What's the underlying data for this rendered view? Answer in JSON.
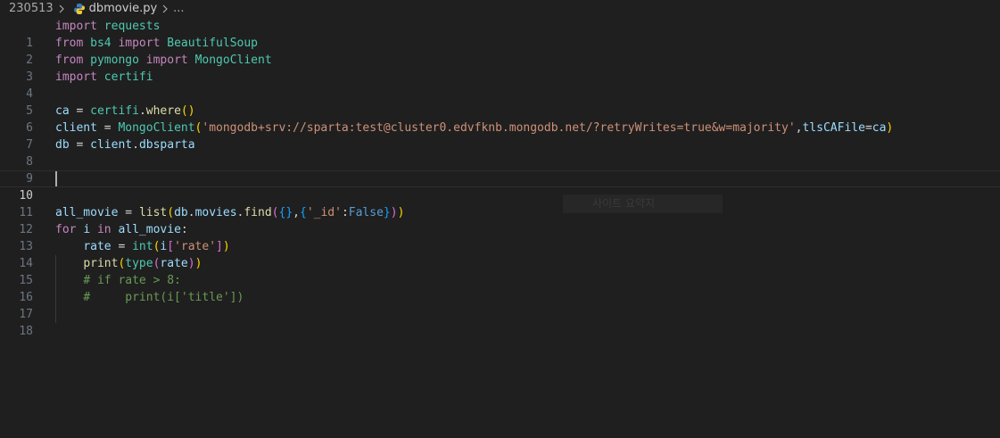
{
  "breadcrumb": {
    "folder": "230513",
    "file": "dbmovie.py",
    "symbol": "..."
  },
  "editor": {
    "language_icon": "python-file-icon",
    "current_line": 10,
    "lines": [
      {
        "n": "1"
      },
      {
        "n": "2"
      },
      {
        "n": "3"
      },
      {
        "n": "4"
      },
      {
        "n": "5"
      },
      {
        "n": "6"
      },
      {
        "n": "7"
      },
      {
        "n": "8"
      },
      {
        "n": "9"
      },
      {
        "n": "10"
      },
      {
        "n": "11"
      },
      {
        "n": "12"
      },
      {
        "n": "13"
      },
      {
        "n": "14"
      },
      {
        "n": "15"
      },
      {
        "n": "16"
      },
      {
        "n": "17"
      },
      {
        "n": "18"
      }
    ],
    "code": {
      "l1": [
        "import",
        " ",
        "requests"
      ],
      "l2": [
        "from",
        " ",
        "bs4",
        " ",
        "import",
        " ",
        "BeautifulSoup"
      ],
      "l3": [
        "from",
        " ",
        "pymongo",
        " ",
        "import",
        " ",
        "MongoClient"
      ],
      "l4": [
        "import",
        " ",
        "certifi"
      ],
      "l6": [
        "ca",
        " = ",
        "certifi",
        ".",
        "where",
        "()"
      ],
      "l7": [
        "client",
        " = ",
        "MongoClient",
        "(",
        "'mongodb+srv://sparta:test@cluster0.edvfknb.mongodb.net/?retryWrites=true&w=majority'",
        ",",
        "tlsCAFile",
        "=",
        "ca",
        ")"
      ],
      "l8": [
        "db",
        " = ",
        "client",
        ".",
        "dbsparta"
      ],
      "l12": [
        "all_movie",
        " = ",
        "list",
        "(",
        "db",
        ".",
        "movies",
        ".",
        "find",
        "(",
        "{}",
        ",",
        "{",
        "'_id'",
        ":",
        "False",
        "}",
        ")",
        ")"
      ],
      "l13": [
        "for",
        " ",
        "i",
        " ",
        "in",
        " ",
        "all_movie",
        ":"
      ],
      "l14": [
        "    ",
        "rate",
        " = ",
        "int",
        "(",
        "i",
        "[",
        "'rate'",
        "]",
        ")"
      ],
      "l15": [
        "    ",
        "print",
        "(",
        "type",
        "(",
        "rate",
        ")",
        ")"
      ],
      "l16": [
        "    ",
        "# if rate > 8:"
      ],
      "l17": [
        "    ",
        "#     print(i['title'])"
      ]
    }
  },
  "hint": {
    "text": "사이트 요약지"
  },
  "colors": {
    "background": "#1f1f1f",
    "keyword": "#c586c0",
    "module": "#4ec9b0",
    "variable": "#9cdcfe",
    "function": "#dcdcaa",
    "string": "#ce9178",
    "comment": "#6a9955"
  }
}
